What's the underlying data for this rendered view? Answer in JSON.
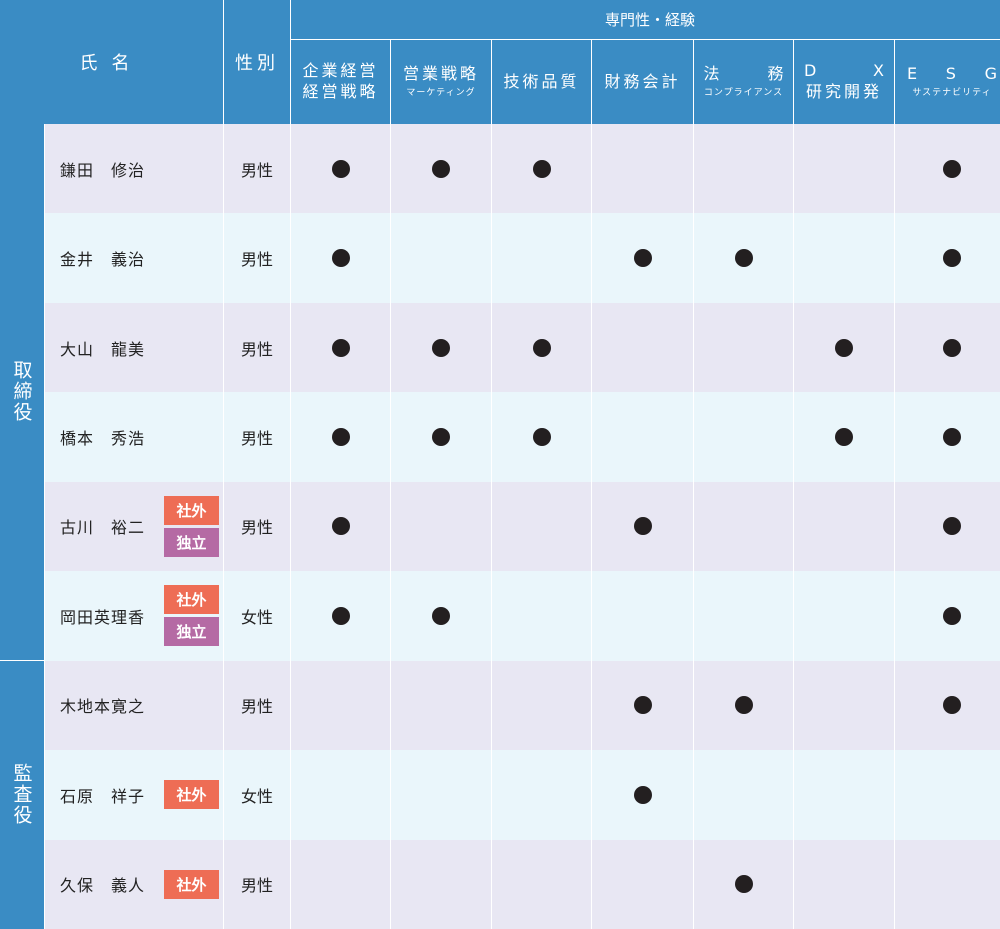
{
  "header": {
    "name": "氏名",
    "gender": "性別",
    "expertise": "専門性・経験",
    "columns": [
      {
        "line1": "企業経営",
        "line2": "経営戦略",
        "sub": ""
      },
      {
        "line1": "営業戦略",
        "line2": "",
        "sub": "マーケティング"
      },
      {
        "line1": "技術品質",
        "line2": "",
        "sub": ""
      },
      {
        "line1": "財務会計",
        "line2": "",
        "sub": ""
      },
      {
        "line1a": "法",
        "line1b": "務",
        "sub": "コンプライアンス"
      },
      {
        "line1a": "D",
        "line1b": "X",
        "line2": "研究開発"
      },
      {
        "letters": [
          "E",
          "S",
          "G"
        ],
        "sub": "サステナビリティ"
      }
    ]
  },
  "groups": {
    "directors": "取締役",
    "auditors": "監査役"
  },
  "badges": {
    "outside": "社外",
    "independent": "独立"
  },
  "people": [
    {
      "name": "鎌田　修治",
      "gender": "男性",
      "outside": false,
      "independent": false,
      "marks": [
        true,
        true,
        true,
        false,
        false,
        false,
        true
      ]
    },
    {
      "name": "金井　義治",
      "gender": "男性",
      "outside": false,
      "independent": false,
      "marks": [
        true,
        false,
        false,
        true,
        true,
        false,
        true
      ]
    },
    {
      "name": "大山　龍美",
      "gender": "男性",
      "outside": false,
      "independent": false,
      "marks": [
        true,
        true,
        true,
        false,
        false,
        true,
        true
      ]
    },
    {
      "name": "橋本　秀浩",
      "gender": "男性",
      "outside": false,
      "independent": false,
      "marks": [
        true,
        true,
        true,
        false,
        false,
        true,
        true
      ]
    },
    {
      "name": "古川　裕二",
      "gender": "男性",
      "outside": true,
      "independent": true,
      "marks": [
        true,
        false,
        false,
        true,
        false,
        false,
        true
      ]
    },
    {
      "name": "岡田英理香",
      "gender": "女性",
      "outside": true,
      "independent": true,
      "marks": [
        true,
        true,
        false,
        false,
        false,
        false,
        true
      ]
    },
    {
      "name": "木地本寛之",
      "gender": "男性",
      "outside": false,
      "independent": false,
      "marks": [
        false,
        false,
        false,
        true,
        true,
        false,
        true
      ]
    },
    {
      "name": "石原　祥子",
      "gender": "女性",
      "outside": true,
      "independent": false,
      "marks": [
        false,
        false,
        false,
        true,
        false,
        false,
        false
      ]
    },
    {
      "name": "久保　義人",
      "gender": "男性",
      "outside": true,
      "independent": false,
      "marks": [
        false,
        false,
        false,
        false,
        true,
        false,
        false
      ]
    }
  ],
  "colors": {
    "header": "#3a8cc4",
    "row_odd": "#e8e7f3",
    "row_even": "#eaf6fb",
    "badge_outside": "#ee6d55",
    "badge_independent": "#b56aa4",
    "mark": "#231f20"
  }
}
